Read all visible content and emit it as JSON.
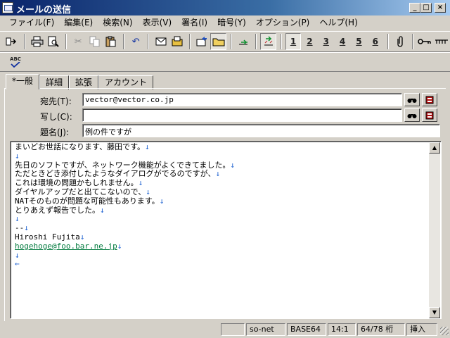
{
  "window": {
    "title": "メールの送信",
    "controls": {
      "minimize": "_",
      "maximize": "□",
      "close": "×"
    }
  },
  "menu": [
    "ファイル(F)",
    "編集(E)",
    "検索(N)",
    "表示(V)",
    "署名(I)",
    "暗号(Y)",
    "オプション(P)",
    "ヘルプ(H)"
  ],
  "toolbar": {
    "icons": [
      "send-icon",
      "print-icon",
      "print-preview-icon",
      "cut-icon",
      "copy-icon",
      "paste-icon",
      "undo-icon",
      "envelope-icon",
      "attach-folder-icon",
      "reply-icon",
      "folder-icon",
      "insert-file-icon",
      "priority-icon"
    ],
    "numbers": [
      "1",
      "2",
      "3",
      "4",
      "5",
      "6"
    ],
    "spell_check_label": "ABC"
  },
  "tabs": [
    "*一般",
    "詳細",
    "拡張",
    "アカウント"
  ],
  "header": {
    "to_label": "宛先(T):",
    "to_value": "vector@vector.co.jp",
    "cc_label": "写し(C):",
    "cc_value": "",
    "subject_label": "題名(J):",
    "subject_value": "例の件ですが"
  },
  "body": {
    "lines": [
      {
        "text": "まいどお世話になります、藤田です。",
        "end": "↓"
      },
      {
        "text": "",
        "end": "↓"
      },
      {
        "text": "先日のソフトですが、ネットワーク機能がよくできてました。",
        "end": "↓"
      },
      {
        "text": "ただときどき添付したようなダイアログがでるのですが、",
        "end": "↓"
      },
      {
        "text": "これは環境の問題かもしれません。",
        "end": "↓"
      },
      {
        "text": "ダイヤルアップだと出てこないので、",
        "end": "↓"
      },
      {
        "text": "NATそのものが問題な可能性もあります。",
        "end": "↓"
      },
      {
        "text": "とりあえず報告でした。",
        "end": "↓"
      },
      {
        "text": "",
        "end": "↓"
      },
      {
        "text": "--",
        "end": "↓"
      },
      {
        "text": "Hiroshi Fujita",
        "end": "↓"
      },
      {
        "text": "hogehoge@foo.bar.ne.jp",
        "end": "↓",
        "link": true
      },
      {
        "text": "",
        "end": "↓"
      },
      {
        "text": "",
        "end": "←"
      }
    ]
  },
  "status": {
    "account": "so-net",
    "encoding": "BASE64",
    "position": "14:1",
    "columns": "64/78 桁",
    "mode": "挿入"
  }
}
